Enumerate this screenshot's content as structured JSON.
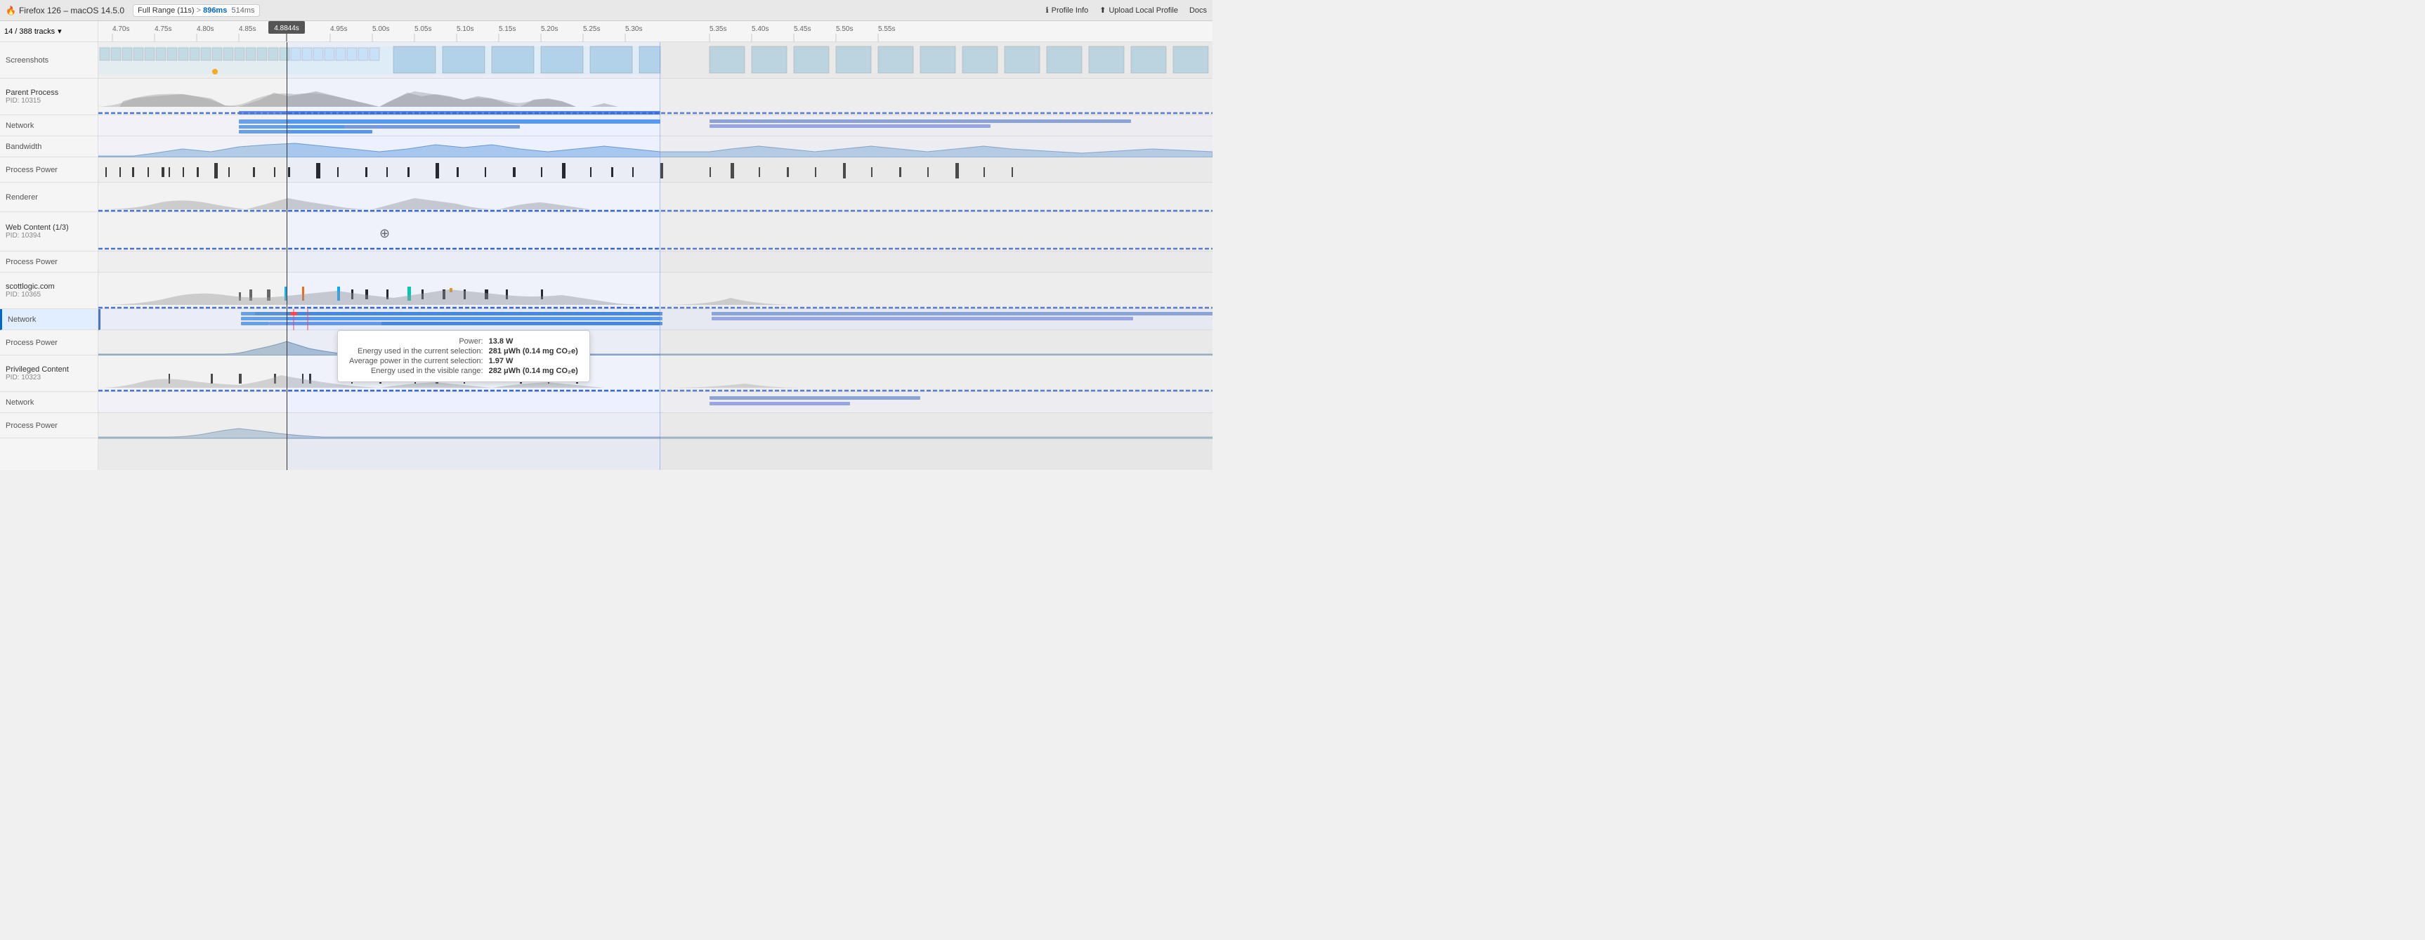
{
  "header": {
    "app_title": "Firefox 126 – macOS 14.5.0",
    "range_label": "Full Range (11s)",
    "range_arrow": ">",
    "range_highlight": "896ms",
    "range_ms": "514ms",
    "profile_info": "Profile Info",
    "upload_label": "Upload Local Profile",
    "docs_label": "Docs"
  },
  "tracks": {
    "count": "14 / 388 tracks",
    "dropdown": "▾"
  },
  "timeline": {
    "ticks": [
      "4.70s",
      "4.75s",
      "4.80s",
      "4.85s",
      "4.8844s",
      "4.95s",
      "5.00s",
      "5.05s",
      "5.10s",
      "5.15s",
      "5.20s",
      "5.25s",
      "5.30s",
      "5.35s",
      "5.40s",
      "5.45s",
      "5.50s",
      "5.55s"
    ],
    "tick_positions": [
      0,
      4.2,
      8.3,
      12.5,
      16.2,
      20.8,
      25,
      29.2,
      33.3,
      37.5,
      41.7,
      45.8,
      50,
      54.2,
      58.3,
      62.5,
      66.7,
      70.8
    ]
  },
  "tooltip": {
    "power_label": "Power:",
    "power_value": "13.8 W",
    "energy_label": "Energy used in the current selection:",
    "energy_value": "281 μWh (0.14 mg CO₂e)",
    "avg_power_label": "Average power in the current selection:",
    "avg_power_value": "1.97 W",
    "energy_visible_label": "Energy used in the visible range:",
    "energy_visible_value": "282 μWh (0.14 mg CO₂e)"
  },
  "processes": [
    {
      "name": "Screenshots",
      "type": "screenshots"
    },
    {
      "name": "Parent Process",
      "pid": "PID: 10315",
      "type": "parent"
    },
    {
      "name": "Network",
      "type": "network"
    },
    {
      "name": "Bandwidth",
      "type": "bandwidth"
    },
    {
      "name": "Process Power",
      "type": "power"
    },
    {
      "name": "Renderer",
      "type": "renderer"
    },
    {
      "name": "Web Content (1/3)",
      "pid": "PID: 10394",
      "type": "webcontent1"
    },
    {
      "name": "Process Power",
      "type": "power"
    },
    {
      "name": "scottlogic.com",
      "pid": "PID: 10365",
      "type": "scottlogic"
    },
    {
      "name": "Network",
      "type": "network",
      "highlighted": true
    },
    {
      "name": "Process Power",
      "type": "power"
    },
    {
      "name": "Privileged Content",
      "pid": "PID: 10323",
      "type": "privileged"
    },
    {
      "name": "Network",
      "type": "network"
    },
    {
      "name": "Process Power",
      "type": "power"
    }
  ]
}
